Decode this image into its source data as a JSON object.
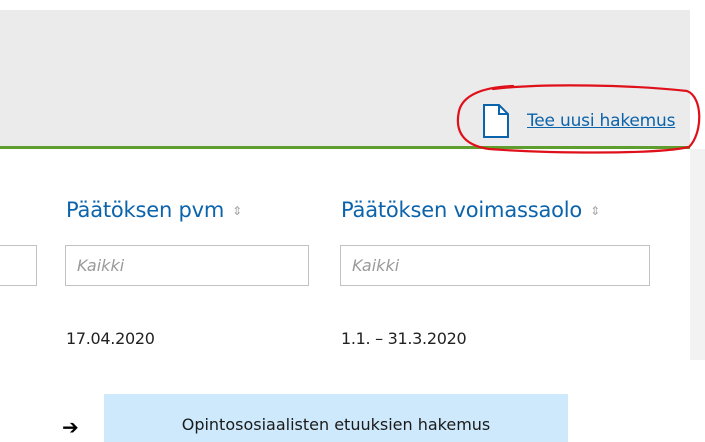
{
  "header": {
    "new_application_label": "Tee uusi hakemus"
  },
  "table": {
    "columns": [
      {
        "label": "Päätöksen pvm",
        "sort_icon": "⇕",
        "filter_placeholder": "Kaikki"
      },
      {
        "label": "Päätöksen voimassaolo",
        "sort_icon": "⇕",
        "filter_placeholder": "Kaikki"
      }
    ],
    "rows": [
      {
        "decision_date": "17.04.2020",
        "validity": "1.1. – 31.3.2020"
      }
    ]
  },
  "footer": {
    "arrow": "➔",
    "benefit_application_label": "Opintososiaalisten etuuksien hakemus"
  },
  "colors": {
    "accent_link": "#0b63ab",
    "header_band": "#ebebeb",
    "divider_green": "#5e9e2f",
    "button_bg": "#cde9fb",
    "annotation_red": "#e0101a"
  },
  "icons": {
    "new_application": "document-icon",
    "sort": "sort-arrows-icon",
    "pointer": "right-arrow-icon"
  }
}
